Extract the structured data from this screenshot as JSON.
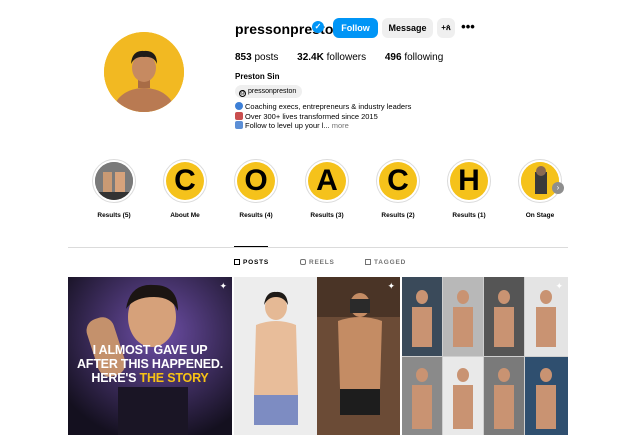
{
  "profile": {
    "username": "pressonpreston",
    "verified_mark": "✓",
    "full_name": "Preston Sin",
    "threads_handle": "pressonpreston",
    "threads_icon_symbol": "@",
    "avatar_bg": "#f2b922"
  },
  "actions": {
    "follow": "Follow",
    "message": "Message",
    "add_user_symbol": "+ጰ",
    "more_symbol": "•••"
  },
  "stats": {
    "posts_count": "853",
    "posts_label": "posts",
    "followers_count": "32.4K",
    "followers_label": "followers",
    "following_count": "496",
    "following_label": "following"
  },
  "bio": {
    "line1": "Coaching execs, entrepreneurs & industry leaders",
    "line2": "Over 300+ lives transformed since 2015",
    "line3": "Follow to level up your l...",
    "more": "more",
    "icons": [
      "globe-icon",
      "rocket-icon",
      "arrows-icon"
    ]
  },
  "highlights": [
    {
      "label": "Results (5)",
      "letter": ""
    },
    {
      "label": "About Me",
      "letter": "C"
    },
    {
      "label": "Results (4)",
      "letter": "O"
    },
    {
      "label": "Results (3)",
      "letter": "A"
    },
    {
      "label": "Results (2)",
      "letter": "C"
    },
    {
      "label": "Results (1)",
      "letter": "H"
    },
    {
      "label": "On Stage",
      "letter": ""
    }
  ],
  "tabs": {
    "posts": "POSTS",
    "reels": "REELS",
    "tagged": "TAGGED"
  },
  "posts": {
    "p1_line1": "I ALMOST GAVE UP",
    "p1_line2": "AFTER THIS HAPPENED.",
    "p1_line3a": "HERE'S ",
    "p1_line3b": "THE STORY",
    "pin_symbol": "📌",
    "accent_yellow": "#f7c215"
  }
}
